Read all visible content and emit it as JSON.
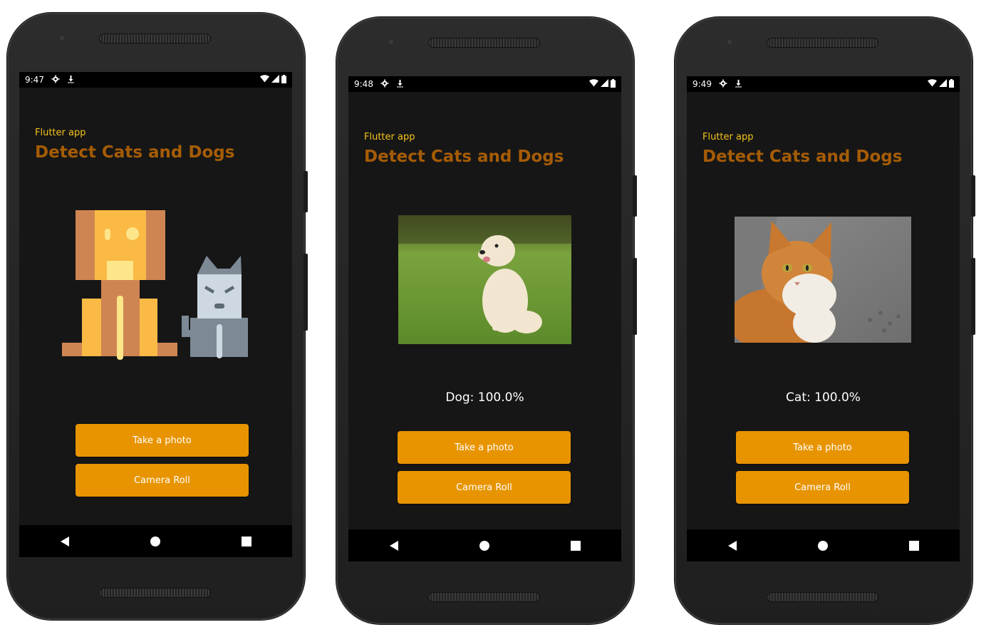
{
  "phones": [
    {
      "status": {
        "time": "9:47"
      },
      "app": {
        "subtitle": "Flutter app",
        "title": "Detect Cats and Dogs"
      },
      "image": "dog-and-cat-illustration",
      "result": "",
      "buttons": {
        "take_photo": "Take a photo",
        "camera_roll": "Camera Roll"
      }
    },
    {
      "status": {
        "time": "9:48"
      },
      "app": {
        "subtitle": "Flutter app",
        "title": "Detect Cats and Dogs"
      },
      "image": "dog-photo",
      "result": "Dog: 100.0%",
      "buttons": {
        "take_photo": "Take a photo",
        "camera_roll": "Camera Roll"
      }
    },
    {
      "status": {
        "time": "9:49"
      },
      "app": {
        "subtitle": "Flutter app",
        "title": "Detect Cats and Dogs"
      },
      "image": "cat-photo",
      "result": "Cat: 100.0%",
      "buttons": {
        "take_photo": "Take a photo",
        "camera_roll": "Camera Roll"
      }
    }
  ],
  "icons": {
    "status_left": [
      "settings-icon",
      "download-icon"
    ],
    "status_right": [
      "wifi-icon",
      "cell-signal-icon",
      "battery-icon"
    ],
    "nav": [
      "back-icon",
      "home-icon",
      "recents-icon"
    ]
  },
  "colors": {
    "screen_bg": "#161616",
    "subtitle": "#f4c21b",
    "title": "#a65c05",
    "button": "#e89400",
    "status_bar": "#000000"
  }
}
